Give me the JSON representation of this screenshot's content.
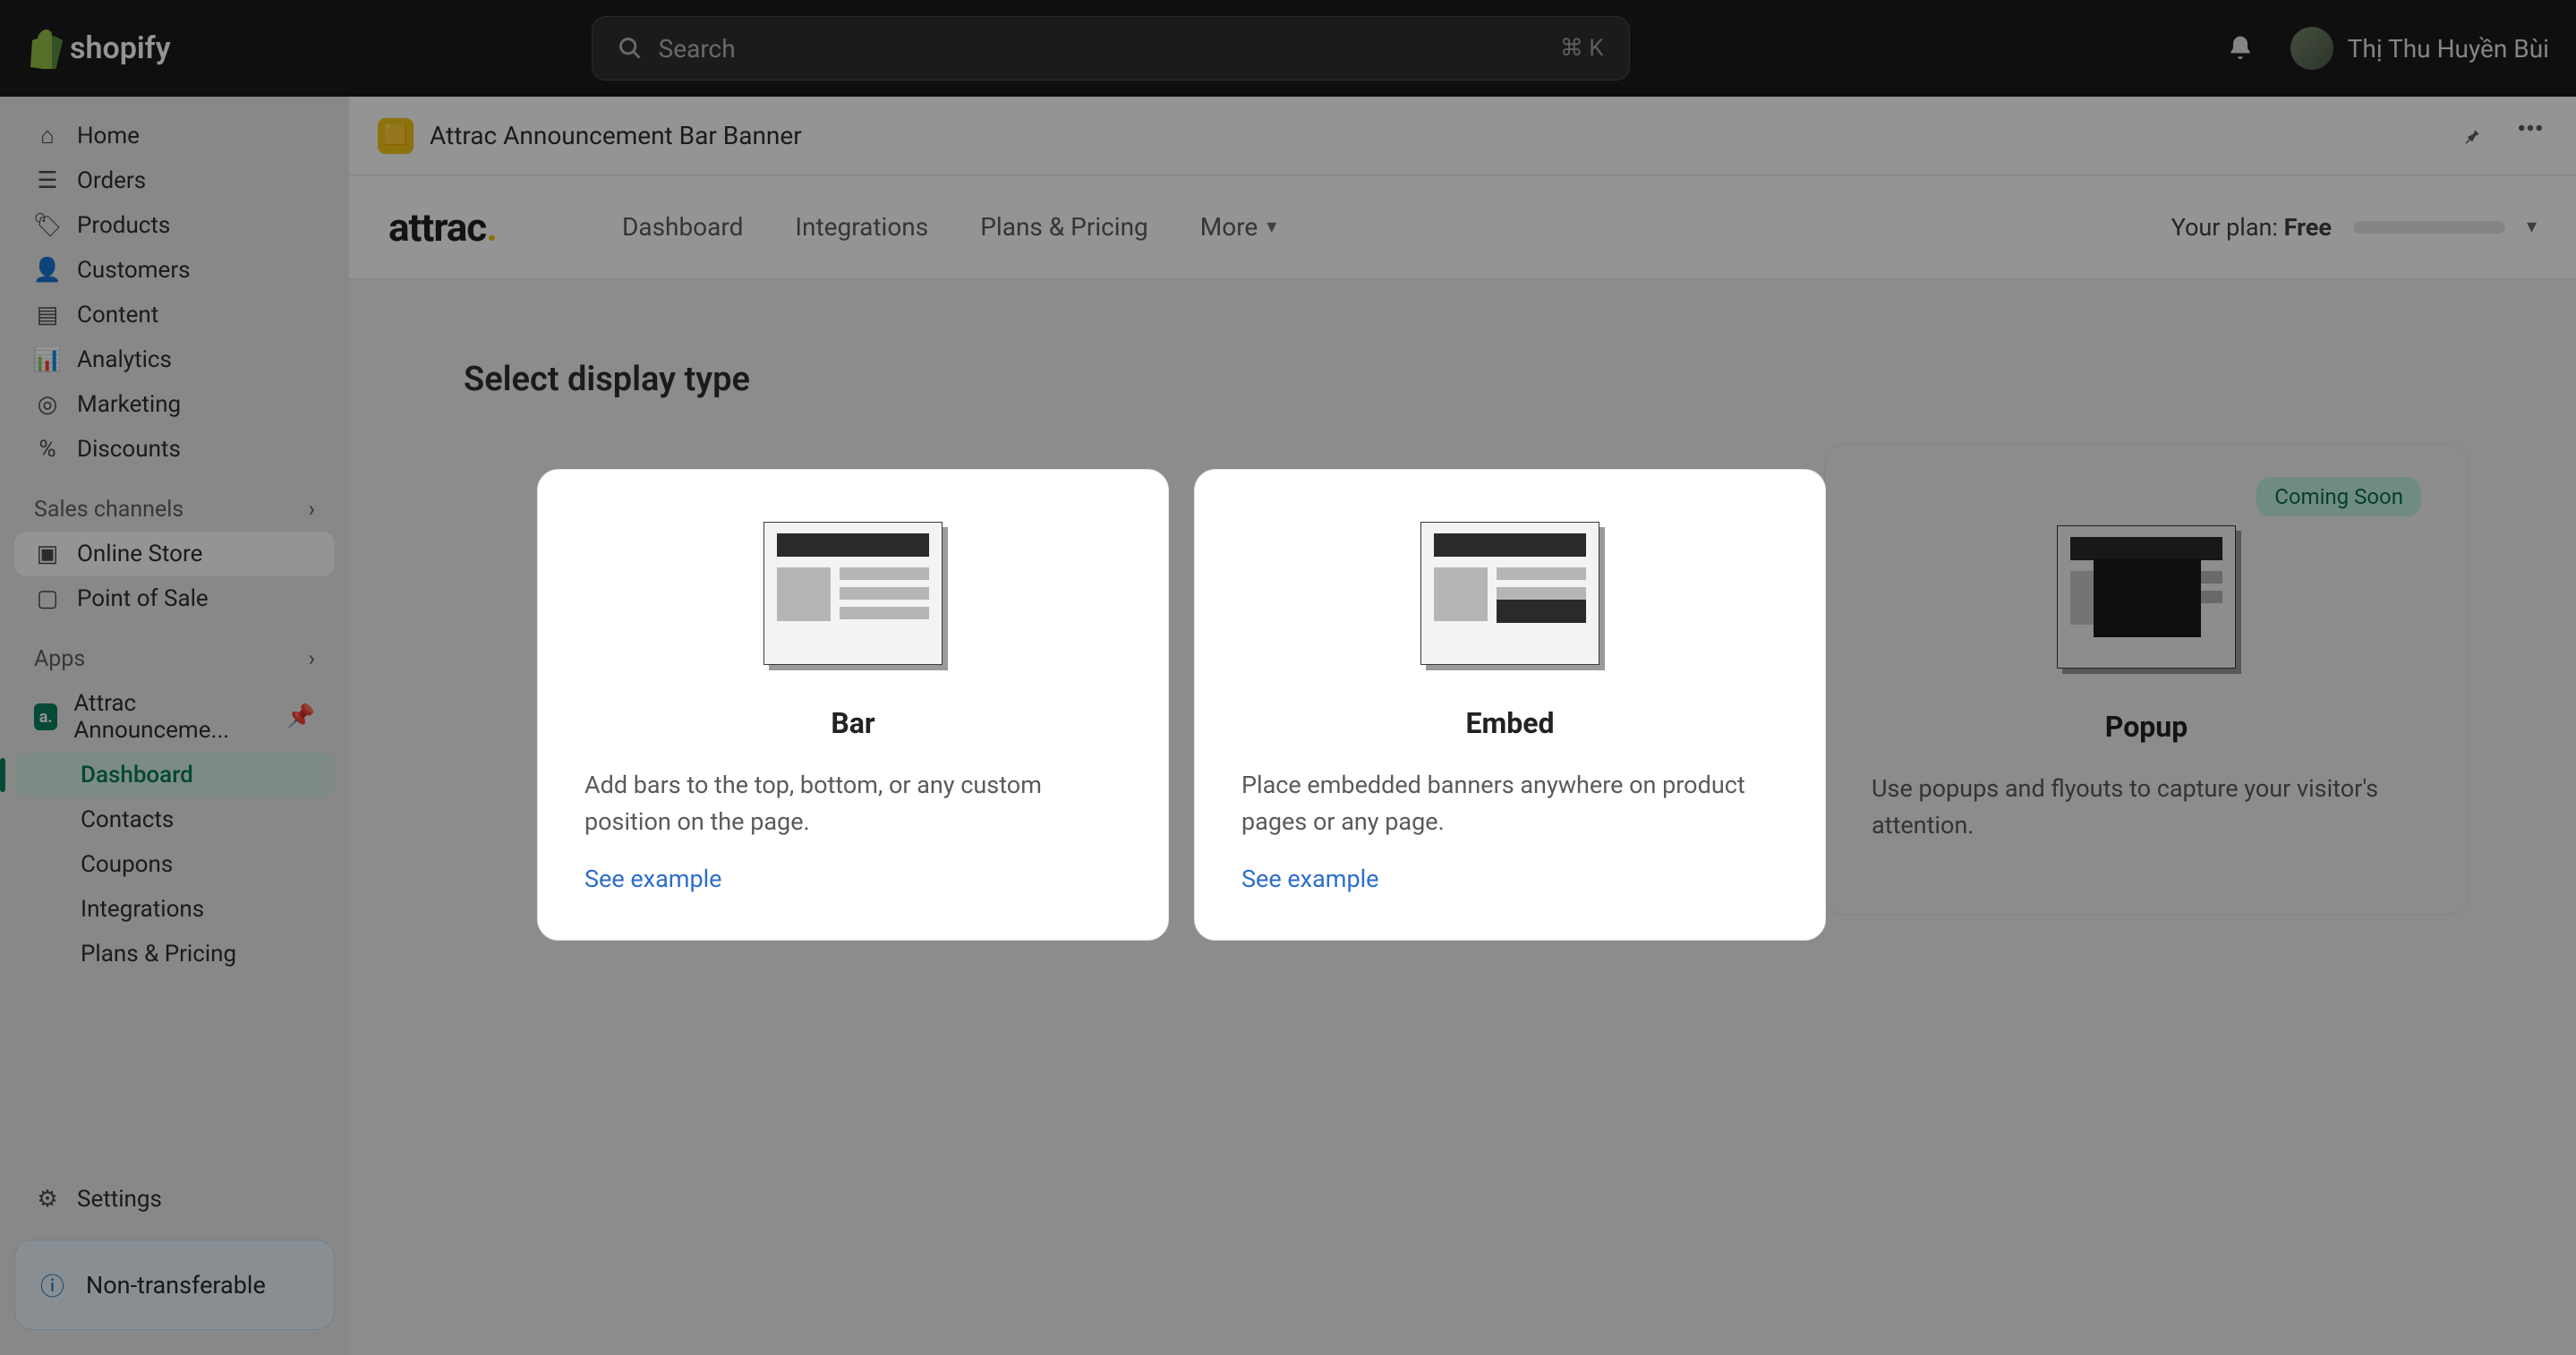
{
  "topbar": {
    "brand": "shopify",
    "search_placeholder": "Search",
    "search_hint": "⌘ K",
    "user_name": "Thị Thu Huyền Bùi"
  },
  "sidebar": {
    "items": [
      {
        "label": "Home",
        "icon": "home"
      },
      {
        "label": "Orders",
        "icon": "orders"
      },
      {
        "label": "Products",
        "icon": "tag"
      },
      {
        "label": "Customers",
        "icon": "person"
      },
      {
        "label": "Content",
        "icon": "content"
      },
      {
        "label": "Analytics",
        "icon": "analytics"
      },
      {
        "label": "Marketing",
        "icon": "target"
      },
      {
        "label": "Discounts",
        "icon": "discount"
      }
    ],
    "sales_channels_label": "Sales channels",
    "channels": [
      {
        "label": "Online Store",
        "selected": true
      },
      {
        "label": "Point of Sale"
      }
    ],
    "apps_label": "Apps",
    "apps": [
      {
        "label": "Attrac Announceme...",
        "pinned": true
      }
    ],
    "app_subnav": [
      {
        "label": "Dashboard",
        "active": true
      },
      {
        "label": "Contacts"
      },
      {
        "label": "Coupons"
      },
      {
        "label": "Integrations"
      },
      {
        "label": "Plans & Pricing"
      }
    ],
    "settings_label": "Settings",
    "badge_text": "Non-transferable"
  },
  "app_header": {
    "title": "Attrac Announcement Bar Banner"
  },
  "app_nav": {
    "brand": "attrac",
    "tabs": [
      "Dashboard",
      "Integrations",
      "Plans & Pricing",
      "More"
    ],
    "plan_label": "Your plan:",
    "plan_value": "Free"
  },
  "page": {
    "title": "Select display type",
    "cards": [
      {
        "title": "Bar",
        "desc": "Add bars to the top, bottom, or any custom position on the page.",
        "link": "See example"
      },
      {
        "title": "Embed",
        "desc": "Place embedded banners anywhere on product pages or any page.",
        "link": "See example"
      },
      {
        "title": "Popup",
        "badge": "Coming Soon",
        "desc": "Use popups and flyouts to capture your visitor's attention."
      }
    ]
  }
}
